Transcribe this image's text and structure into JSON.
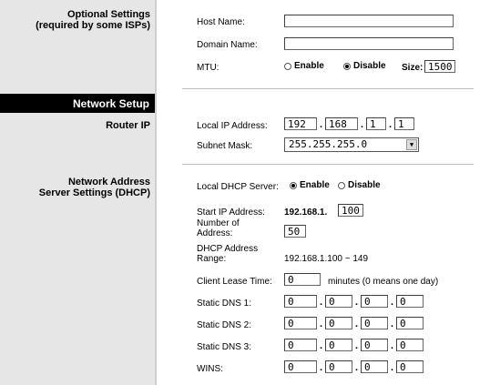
{
  "sidebar": {
    "optional_title": "Optional Settings",
    "optional_sub": "(required by some ISPs)",
    "network_setup": "Network Setup",
    "router_ip": "Router IP",
    "dhcp_title": "Network Address",
    "dhcp_sub": "Server Settings (DHCP)"
  },
  "optional": {
    "host_label": "Host Name:",
    "host_value": "",
    "domain_label": "Domain Name:",
    "domain_value": "",
    "mtu_label": "MTU:",
    "mtu_enable": "Enable",
    "mtu_disable": "Disable",
    "mtu_selected": "Disable",
    "size_label": "Size:",
    "size_value": "1500"
  },
  "router_ip": {
    "local_ip_label": "Local IP Address:",
    "ip": [
      "192",
      "168",
      "1",
      "1"
    ],
    "subnet_label": "Subnet Mask:",
    "subnet_value": "255.255.255.0"
  },
  "dhcp": {
    "server_label": "Local DHCP Server:",
    "enable": "Enable",
    "disable": "Disable",
    "selected": "Enable",
    "start_label": "Start IP Address:",
    "start_prefix": "192.168.1.",
    "start_value": "100",
    "number_label": "Number of Address:",
    "number_value": "50",
    "range_label": "DHCP Address Range:",
    "range_value": "192.168.1.100 ~ 149",
    "lease_label": "Client Lease Time:",
    "lease_value": "0",
    "lease_note": "minutes (0 means one day)",
    "dns1_label": "Static DNS 1:",
    "dns1": [
      "0",
      "0",
      "0",
      "0"
    ],
    "dns2_label": "Static DNS 2:",
    "dns2": [
      "0",
      "0",
      "0",
      "0"
    ],
    "dns3_label": "Static DNS 3:",
    "dns3": [
      "0",
      "0",
      "0",
      "0"
    ],
    "wins_label": "WINS:",
    "wins": [
      "0",
      "0",
      "0",
      "0"
    ]
  }
}
